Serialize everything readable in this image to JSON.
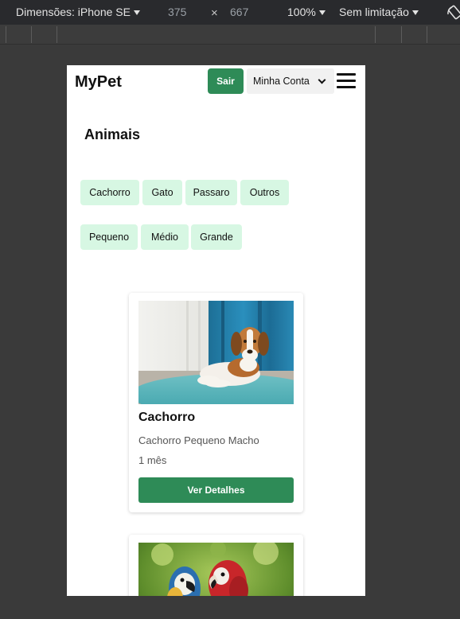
{
  "devtools": {
    "device_label": "Dimensões: iPhone SE",
    "width_value": "375",
    "times_symbol": "×",
    "height_value": "667",
    "zoom": "100%",
    "throttling": "Sem limitação",
    "rotate_icon": "rotate-icon"
  },
  "app": {
    "brand": "MyPet",
    "logout_label": "Sair",
    "account_label": "Minha Conta",
    "menu_icon": "hamburger-icon",
    "primary_color": "#2e8b57",
    "chip_color": "#d7f7e3"
  },
  "filters": {
    "title": "Animais",
    "species": [
      "Cachorro",
      "Gato",
      "Passaro",
      "Outros"
    ],
    "sizes": [
      "Pequeno",
      "Médio",
      "Grande"
    ]
  },
  "cards": [
    {
      "title": "Cachorro",
      "subtitle": "Cachorro Pequeno Macho",
      "age": "1 mês",
      "button_label": "Ver Detalhes",
      "image": "beagle-photo"
    },
    {
      "image": "parrots-photo"
    }
  ]
}
